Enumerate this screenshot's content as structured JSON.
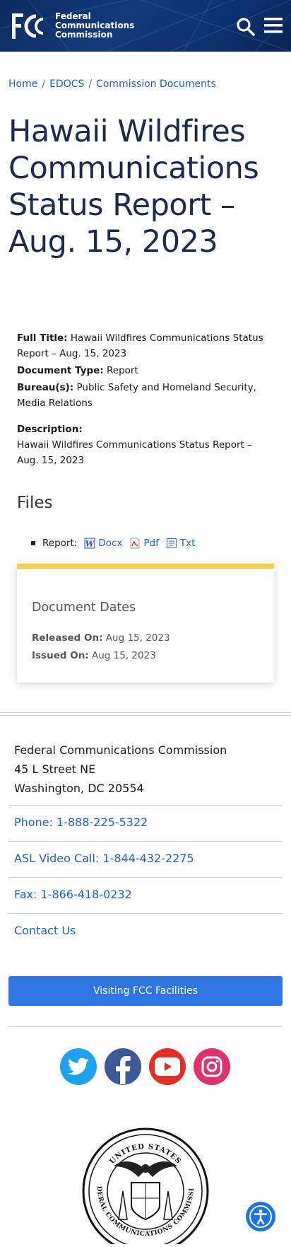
{
  "header": {
    "logo_line1": "Federal",
    "logo_line2": "Communications",
    "logo_line3": "Commission"
  },
  "breadcrumb": [
    "Home",
    "EDOCS",
    "Commission Documents"
  ],
  "page_title": "Hawaii Wildfires Communications Status Report – Aug. 15, 2023",
  "meta": {
    "full_title_label": "Full Title:",
    "full_title_value": "Hawaii Wildfires Communications Status Report – Aug. 15, 2023",
    "doc_type_label": "Document Type:",
    "doc_type_value": "Report",
    "bureau_label": "Bureau(s):",
    "bureau_value": "Public Safety and Homeland Security, Media Relations",
    "description_label": "Description:",
    "description_value": "Hawaii Wildfires Communications Status Report – Aug. 15, 2023"
  },
  "files": {
    "heading": "Files",
    "item_label": "Report:",
    "links": [
      "Docx",
      "Pdf",
      "Txt"
    ]
  },
  "dates": {
    "heading": "Document Dates",
    "released_label": "Released On:",
    "released_value": "Aug 15, 2023",
    "issued_label": "Issued On:",
    "issued_value": "Aug 15, 2023"
  },
  "footer": {
    "addr_line1": "Federal Communications Commission",
    "addr_line2": "45 L Street NE",
    "addr_line3": "Washington, DC 20554",
    "phone": "Phone: 1-888-225-5322",
    "asl": "ASL Video Call: 1-844-432-2275",
    "fax": "Fax: 1-866-418-0232",
    "contact": "Contact Us",
    "visit_button": "Visiting FCC Facilities"
  },
  "seal_text": "UNITED STATES FEDERAL COMMUNICATIONS COMMISSION",
  "colors": {
    "header_bg": "#123a7a",
    "link": "#1e60c8",
    "accent_yellow": "#f5cf3f",
    "button_blue": "#2f74e1",
    "twitter": "#1da1f2",
    "facebook": "#3b5998",
    "youtube": "#e52d27",
    "instagram": "#e1306c"
  },
  "social_icons": [
    "twitter-icon",
    "facebook-icon",
    "youtube-icon",
    "instagram-icon"
  ]
}
